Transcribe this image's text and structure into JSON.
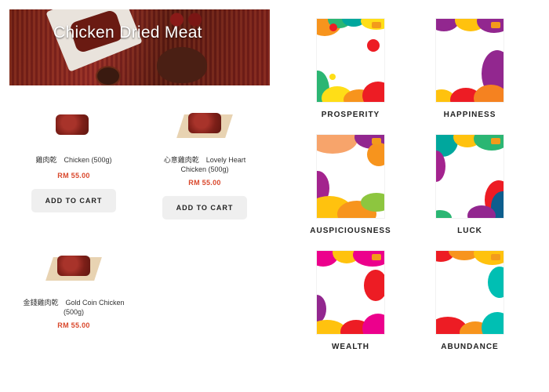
{
  "banner": {
    "title": "Chicken Dried Meat"
  },
  "products": [
    {
      "name": "雞肉乾　Chicken (500g)",
      "price": "RM 55.00",
      "button": "ADD TO CART"
    },
    {
      "name": "心意雞肉乾　Lovely Heart Chicken (500g)",
      "price": "RM 55.00",
      "button": "ADD TO CART"
    },
    {
      "name": "金錢雞肉乾　Gold Coin Chicken (500g)",
      "price": "RM 55.00"
    }
  ],
  "cards": [
    {
      "label": "PROSPERITY"
    },
    {
      "label": "HAPPINESS"
    },
    {
      "label": "AUSPICIOUSNESS"
    },
    {
      "label": "LUCK"
    },
    {
      "label": "WEALTH"
    },
    {
      "label": "ABUNDANCE"
    }
  ],
  "colors": {
    "price": "#d9472b",
    "button_bg": "#efefef"
  }
}
